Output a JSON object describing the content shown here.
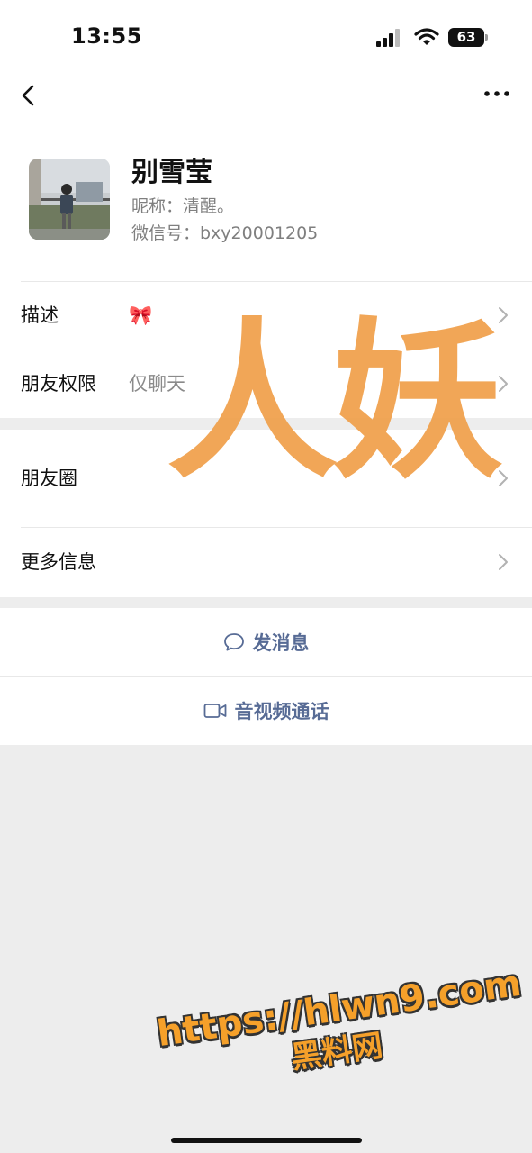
{
  "status_bar": {
    "time": "13:55",
    "battery": "63"
  },
  "profile": {
    "name": "别雪莹",
    "nickname": "昵称：清醒。",
    "wechat_id": "微信号：bxy20001205"
  },
  "rows": {
    "description": {
      "label": "描述",
      "value": "🎀"
    },
    "permission": {
      "label": "朋友权限",
      "value": "仅聊天"
    },
    "moments": {
      "label": "朋友圈"
    },
    "more_info": {
      "label": "更多信息"
    }
  },
  "actions": {
    "message": "发消息",
    "call": "音视频通话"
  },
  "overlays": {
    "watermark": "人妖",
    "url": "https://hlwn9.com",
    "site_name": "黑料网"
  },
  "icons": {
    "back": "chevron-left-icon",
    "more": "ellipsis-icon",
    "chevron": "chevron-right-icon",
    "message": "chat-bubble-icon",
    "call": "video-camera-icon"
  },
  "colors": {
    "accent": "#576b95",
    "watermark": "#f0a04b",
    "background": "#ededed"
  }
}
